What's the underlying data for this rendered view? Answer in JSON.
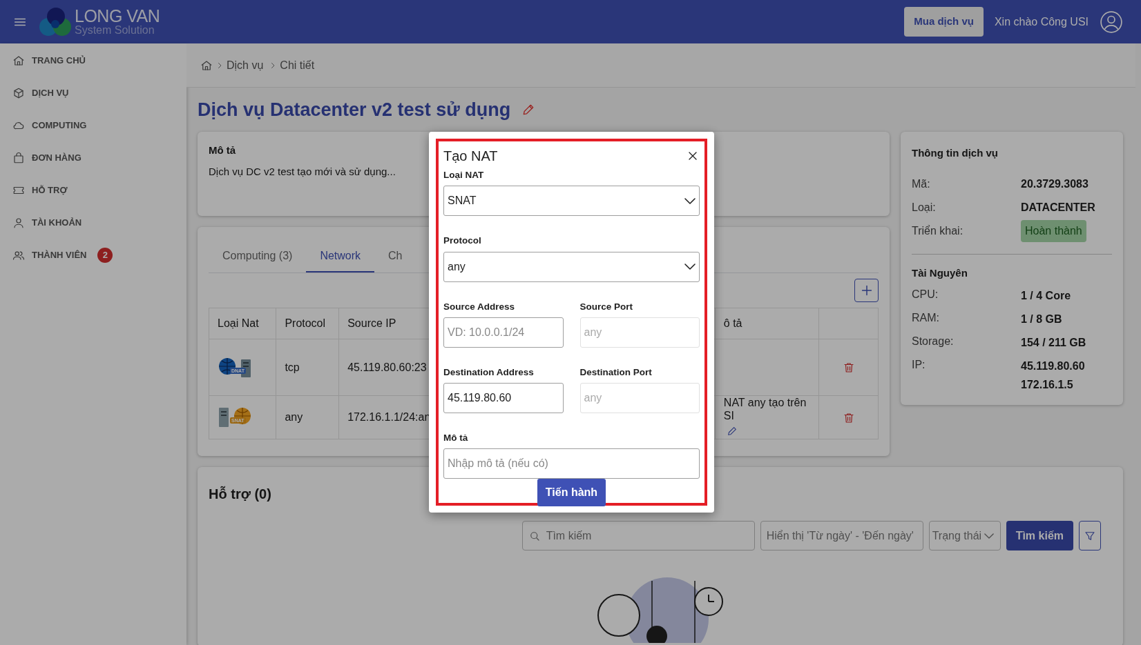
{
  "header": {
    "brand_name": "LONG VAN",
    "brand_tagline": "System Solution",
    "buy_button": "Mua dịch vụ",
    "greeting": "Xin chào Công USI"
  },
  "sidebar": {
    "items": [
      {
        "kind": "home",
        "label": "TRANG CHỦ"
      },
      {
        "kind": "box",
        "label": "DỊCH VỤ"
      },
      {
        "kind": "cloud",
        "label": "COMPUTING"
      },
      {
        "kind": "bag",
        "label": "ĐƠN HÀNG"
      },
      {
        "kind": "ticket",
        "label": "HỖ TRỢ"
      },
      {
        "kind": "user",
        "label": "TÀI KHOẢN"
      },
      {
        "kind": "users",
        "label": "THÀNH VIÊN",
        "badge": "2"
      }
    ]
  },
  "breadcrumb": [
    "Dịch vụ",
    "Chi tiết"
  ],
  "page_title": "Dịch vụ Datacenter v2 test sử dụng",
  "description_card": {
    "title": "Mô tả",
    "text": "Dịch vụ DC v2 test tạo mới và sử dụng..."
  },
  "tabs": [
    {
      "label": "Computing (3)",
      "selected": false
    },
    {
      "label": "Network",
      "selected": true
    },
    {
      "label": "Ch",
      "selected": false
    }
  ],
  "nat_table": {
    "columns": [
      "Loại Nat",
      "Protocol",
      "Source IP",
      "ô tả"
    ],
    "rows": [
      {
        "kind": "dnat",
        "nat_label": "DNAT",
        "protocol": "tcp",
        "source_ip": "45.119.80.60:23",
        "description_lines": []
      },
      {
        "kind": "snat",
        "nat_label": "SNAT",
        "protocol": "any",
        "source_ip": "172.16.1.1/24:an",
        "description_lines": [
          "NAT any tạo trên",
          "SI"
        ]
      }
    ]
  },
  "support": {
    "title": "Hỗ trợ (0)",
    "search_placeholder": "Tìm kiếm",
    "date_placeholder": "Hiển thị 'Từ ngày' - 'Đến ngày'",
    "status_select": "Trạng thái",
    "search_button": "Tìm kiếm"
  },
  "service_info": {
    "title": "Thông tin dịch vụ",
    "rows": [
      {
        "kind": "text",
        "label": "Mã:",
        "value": "20.3729.3083"
      },
      {
        "kind": "text",
        "label": "Loại:",
        "value": "DATACENTER"
      },
      {
        "kind": "status",
        "label": "Triển khai:",
        "value": "Hoàn thành"
      }
    ],
    "resources_title": "Tài Nguyên",
    "resources": [
      {
        "label": "CPU:",
        "values": [
          "1 / 4 Core"
        ]
      },
      {
        "label": "RAM:",
        "values": [
          "1 / 8 GB"
        ]
      },
      {
        "label": "Storage:",
        "values": [
          "154 / 211 GB"
        ]
      },
      {
        "label": "IP:",
        "values": [
          "45.119.80.60",
          "172.16.1.5"
        ]
      }
    ]
  },
  "modal": {
    "title": "Tạo NAT",
    "highlighted": true,
    "rows": [
      [
        {
          "kind": "select",
          "label": "Loại NAT",
          "value": "SNAT"
        }
      ],
      [
        {
          "kind": "select",
          "label": "Protocol",
          "value": "any"
        }
      ],
      [
        {
          "kind": "input",
          "label": "Source Address",
          "placeholder": "VD: 10.0.0.1/24",
          "disabled": false
        },
        {
          "kind": "input",
          "label": "Source Port",
          "placeholder": "any",
          "disabled": true
        }
      ],
      [
        {
          "kind": "input",
          "label": "Destination Address",
          "value": "45.119.80.60",
          "disabled": false
        },
        {
          "kind": "input",
          "label": "Destination Port",
          "placeholder": "any",
          "disabled": true
        }
      ],
      [
        {
          "kind": "input",
          "label": "Mô tả",
          "placeholder": "Nhập mô tả (nếu có)",
          "disabled": false
        }
      ]
    ],
    "submit_button": "Tiến hành"
  }
}
